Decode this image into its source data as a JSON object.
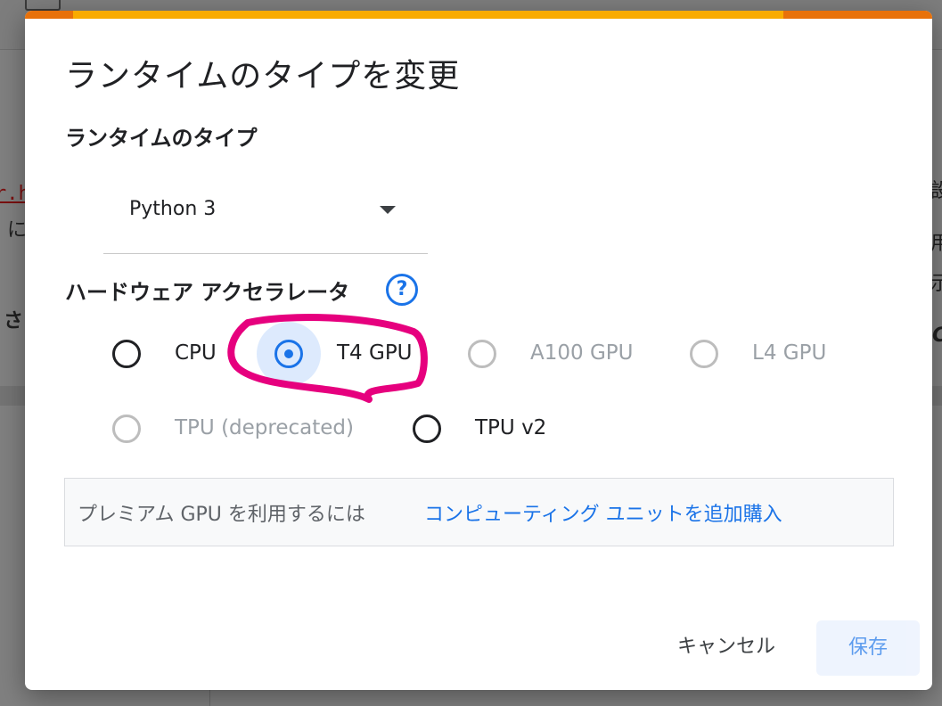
{
  "background": {
    "link_fragment": "r.h",
    "text_ni": "に",
    "text_sa": "さ",
    "right_glyph_1": "設",
    "right_glyph_2": "用",
    "right_glyph_3": "示",
    "right_glyph_4": "C"
  },
  "dialog": {
    "title": "ランタイムのタイプを変更",
    "runtime_section_label": "ランタイムのタイプ",
    "runtime_select": {
      "value": "Python 3"
    },
    "hardware_section_label": "ハードウェア アクセラレータ",
    "help_icon_glyph": "?",
    "accelerators": [
      {
        "label": "CPU",
        "selected": false,
        "disabled": false
      },
      {
        "label": "T4 GPU",
        "selected": true,
        "disabled": false
      },
      {
        "label": "A100 GPU",
        "selected": false,
        "disabled": true
      },
      {
        "label": "L4 GPU",
        "selected": false,
        "disabled": true
      },
      {
        "label": "TPU (deprecated)",
        "selected": false,
        "disabled": true
      },
      {
        "label": "TPU v2",
        "selected": false,
        "disabled": false
      }
    ],
    "premium_info_text": "プレミアム GPU を利用するには",
    "premium_info_link": "コンピューティング ユニットを追加購入",
    "cancel_label": "キャンセル",
    "save_label": "保存"
  },
  "colors": {
    "accent": "#1a73e8",
    "progress_orange": "#e8710a",
    "progress_yellow": "#f9ab00",
    "annotation_magenta": "#e6007e",
    "disabled_gray": "#9aa0a6"
  }
}
